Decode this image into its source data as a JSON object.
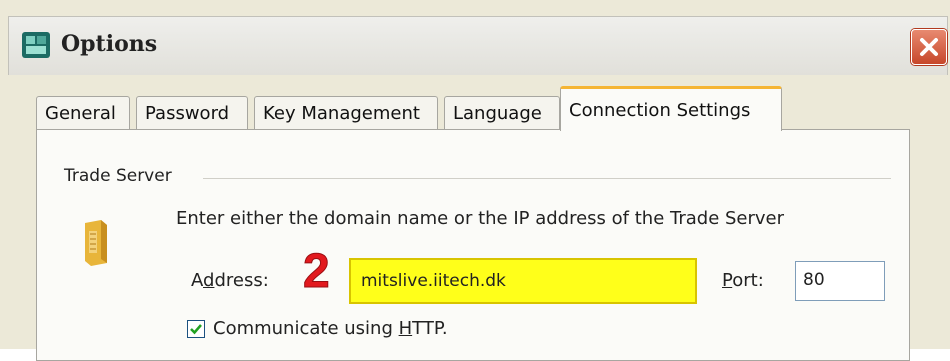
{
  "window": {
    "title": "Options",
    "close_icon": "close-icon",
    "app_icon": "app-icon"
  },
  "tabs": [
    {
      "label": "General",
      "active": false
    },
    {
      "label": "Password",
      "active": false
    },
    {
      "label": "Key Management",
      "active": false
    },
    {
      "label": "Language",
      "active": false
    },
    {
      "label": "Connection Settings",
      "active": true
    }
  ],
  "trade_server": {
    "group_label": "Trade Server",
    "icon": "server-icon",
    "instruction": "Enter either the domain name or the IP address of the Trade Server",
    "address_label_pre": "A",
    "address_label_mnemonic": "d",
    "address_label_post": "dress:",
    "address_value": "mitslive.iitech.dk",
    "port_label_mnemonic": "P",
    "port_label_post": "ort:",
    "port_value": "80",
    "http_checked": true,
    "http_label_pre": "Communicate using ",
    "http_label_mnemonic": "H",
    "http_label_post": "TTP."
  },
  "annotation": {
    "step_number": "2"
  },
  "colors": {
    "highlight": "#ffff1a",
    "active_tab_accent": "#f5b534",
    "close_button": "#c7472a",
    "step_number": "#e2191e"
  }
}
